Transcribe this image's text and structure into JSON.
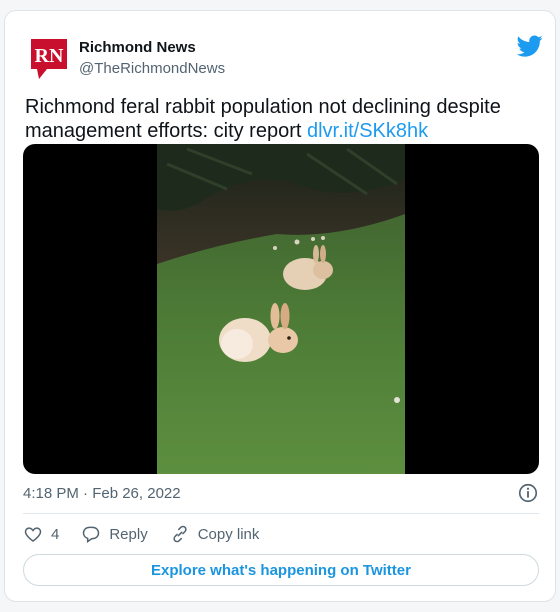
{
  "author": {
    "name": "Richmond News",
    "handle": "@TheRichmondNews",
    "logo_text": "RN"
  },
  "tweet": {
    "text": "Richmond feral rabbit population not declining despite management efforts: city report ",
    "link": "dlvr.it/SKk8hk",
    "timestamp": "4:18 PM · Feb 26, 2022"
  },
  "actions": {
    "like_count": "4",
    "reply_label": "Reply",
    "copy_label": "Copy link"
  },
  "footer": {
    "explore_label": "Explore what's happening on Twitter"
  },
  "icons": {
    "brand": "twitter-bird-icon",
    "info": "info-icon",
    "like": "heart-icon",
    "reply": "reply-bubble-icon",
    "copy": "link-icon"
  },
  "colors": {
    "accent": "#1d9bf0",
    "text": "#0f1419",
    "muted": "#536471",
    "logo_red": "#c8102e"
  }
}
